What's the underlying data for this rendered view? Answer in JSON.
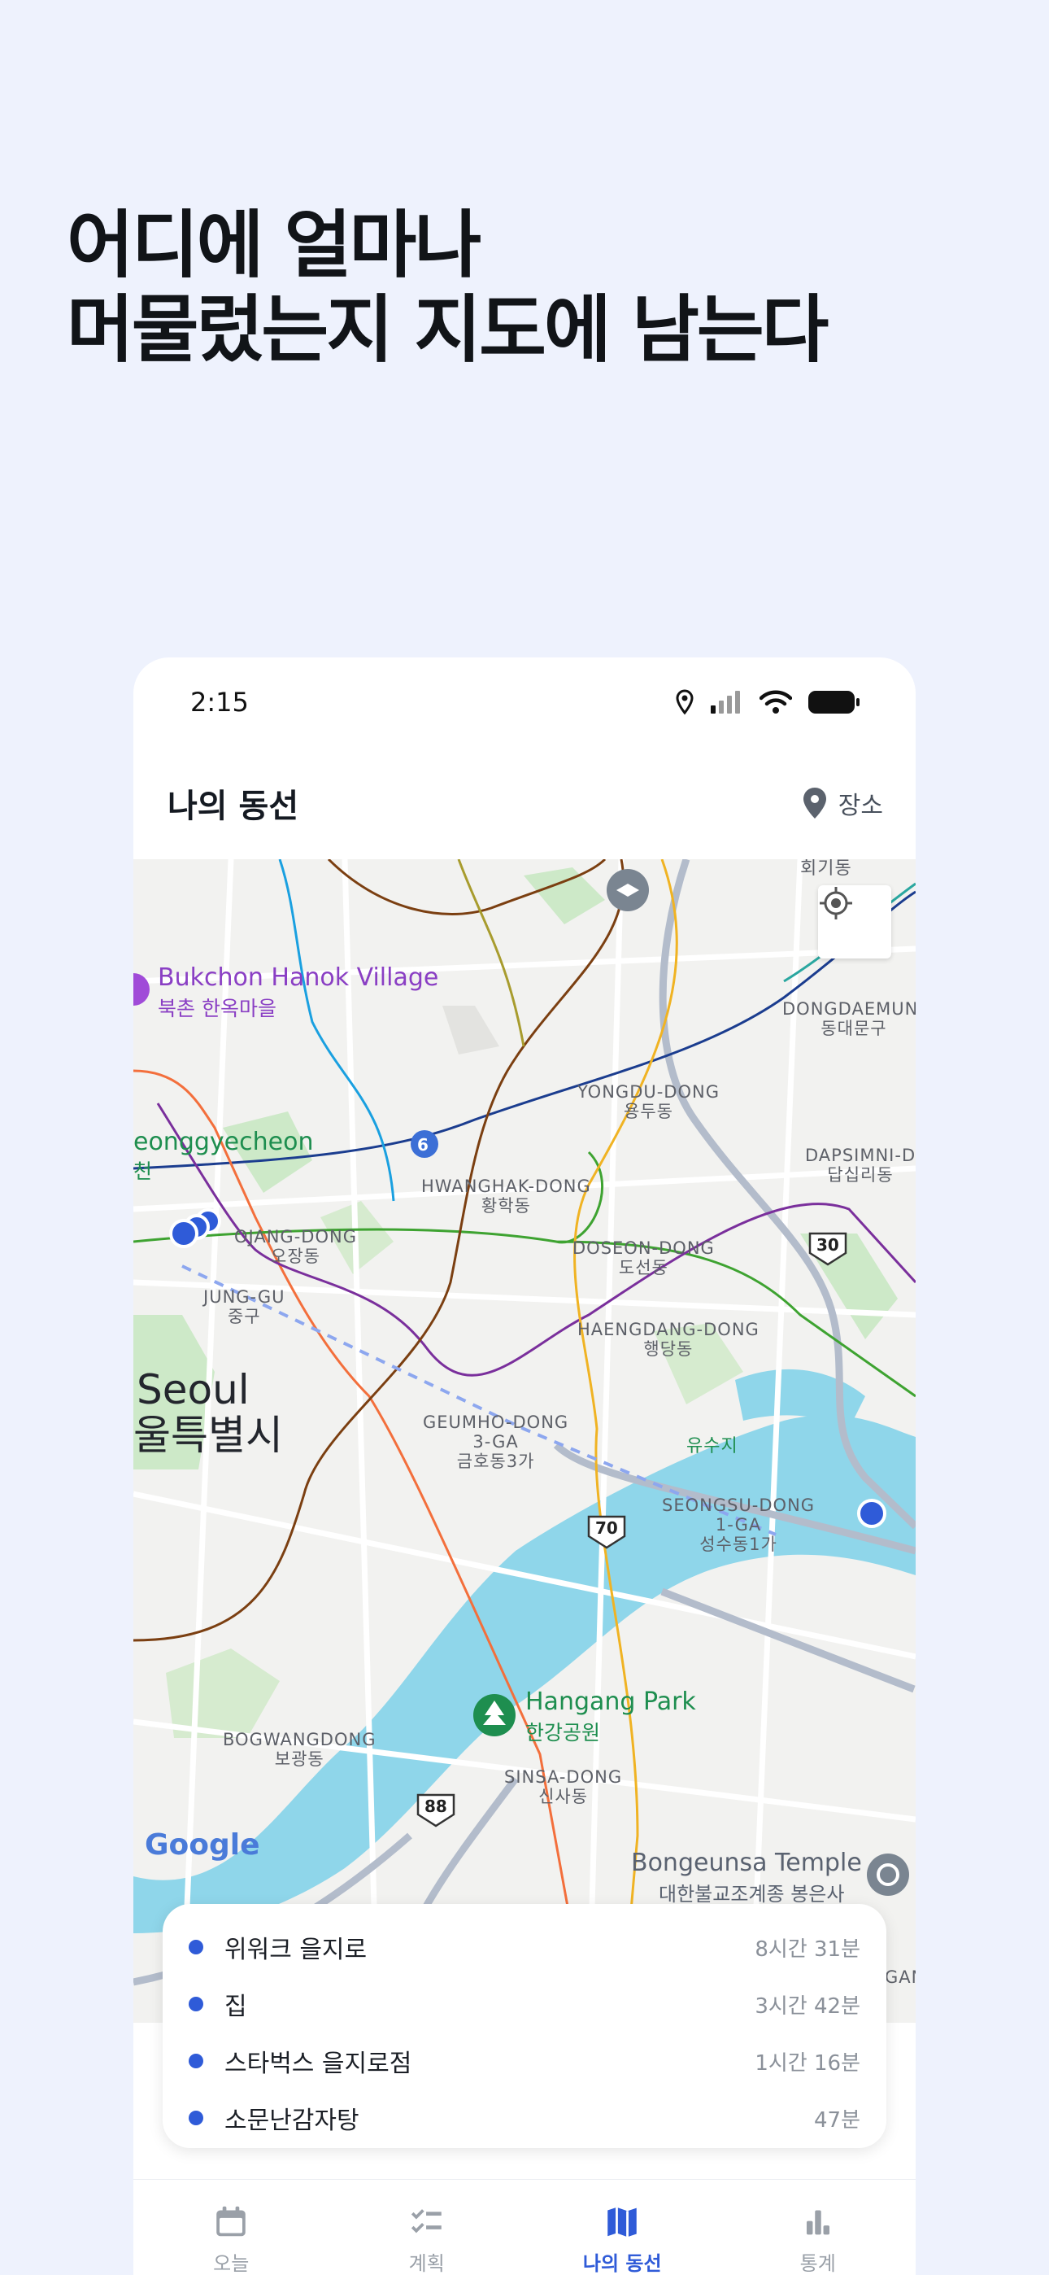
{
  "headline": {
    "line1": "어디에 얼마나",
    "line2": "머물렀는지 지도에 남는다"
  },
  "status_bar": {
    "time": "2:15"
  },
  "app_bar": {
    "title": "나의 동선",
    "places_label": "장소"
  },
  "map": {
    "labels": {
      "hoegi": "회기동",
      "bukchon_en": "Bukchon Hanok Village",
      "bukchon_ko": "북촌 한옥마을",
      "dongdaemun": "DONGDAEMUN-\n동대문구",
      "yongdu": "YONGDU-DONG\n용두동",
      "cheonggye": "eonggyecheon",
      "cheonggye_ko": "천",
      "dapsimni": "DAPSIMNI-D\n답십리동",
      "hwanghak": "HWANGHAK-DONG\n황학동",
      "ojang": "OJANG-DONG\n오장동",
      "doseon": "DOSEON-DONG\n도선동",
      "junggu": "JUNG-GU\n중구",
      "haengdang": "HAENGDANG-DONG\n행당동",
      "seoul_en": "Seoul",
      "seoul_ko": "울특별시",
      "geumho": "GEUMHO-DONG\n3-GA\n금호동3가",
      "yusuji": "유수지",
      "seongsu": "SEONGSU-DONG\n1-GA\n성수동1가",
      "hangang_en": "Hangang Park",
      "hangang_ko": "한강공원",
      "bogwang": "BOGWANGDONG\n보광동",
      "sinsa": "SINSA-DONG\n신사동",
      "bongeunsa_en": "Bongeunsa Temple",
      "bongeunsa_ko": "대한불교조계종 봉은사",
      "gan": "GAN",
      "route_6": "6",
      "route_30": "30",
      "route_70": "70",
      "route_88": "88",
      "google": "Google"
    }
  },
  "visits": [
    {
      "name": "위워크 을지로",
      "duration": "8시간  31분"
    },
    {
      "name": "집",
      "duration": "3시간  42분"
    },
    {
      "name": "스타벅스 을지로점",
      "duration": "1시간  16분"
    },
    {
      "name": "소문난감자탕",
      "duration": "47분"
    }
  ],
  "tabs": [
    {
      "label": "오늘",
      "icon": "calendar-icon"
    },
    {
      "label": "계획",
      "icon": "checklist-icon"
    },
    {
      "label": "나의 동선",
      "icon": "map-icon"
    },
    {
      "label": "통계",
      "icon": "bar-chart-icon"
    }
  ],
  "colors": {
    "accent": "#2f5bd8",
    "visit_dot": "#2f5bd8",
    "water": "#8fd6ea",
    "background": "#eef2fd"
  }
}
